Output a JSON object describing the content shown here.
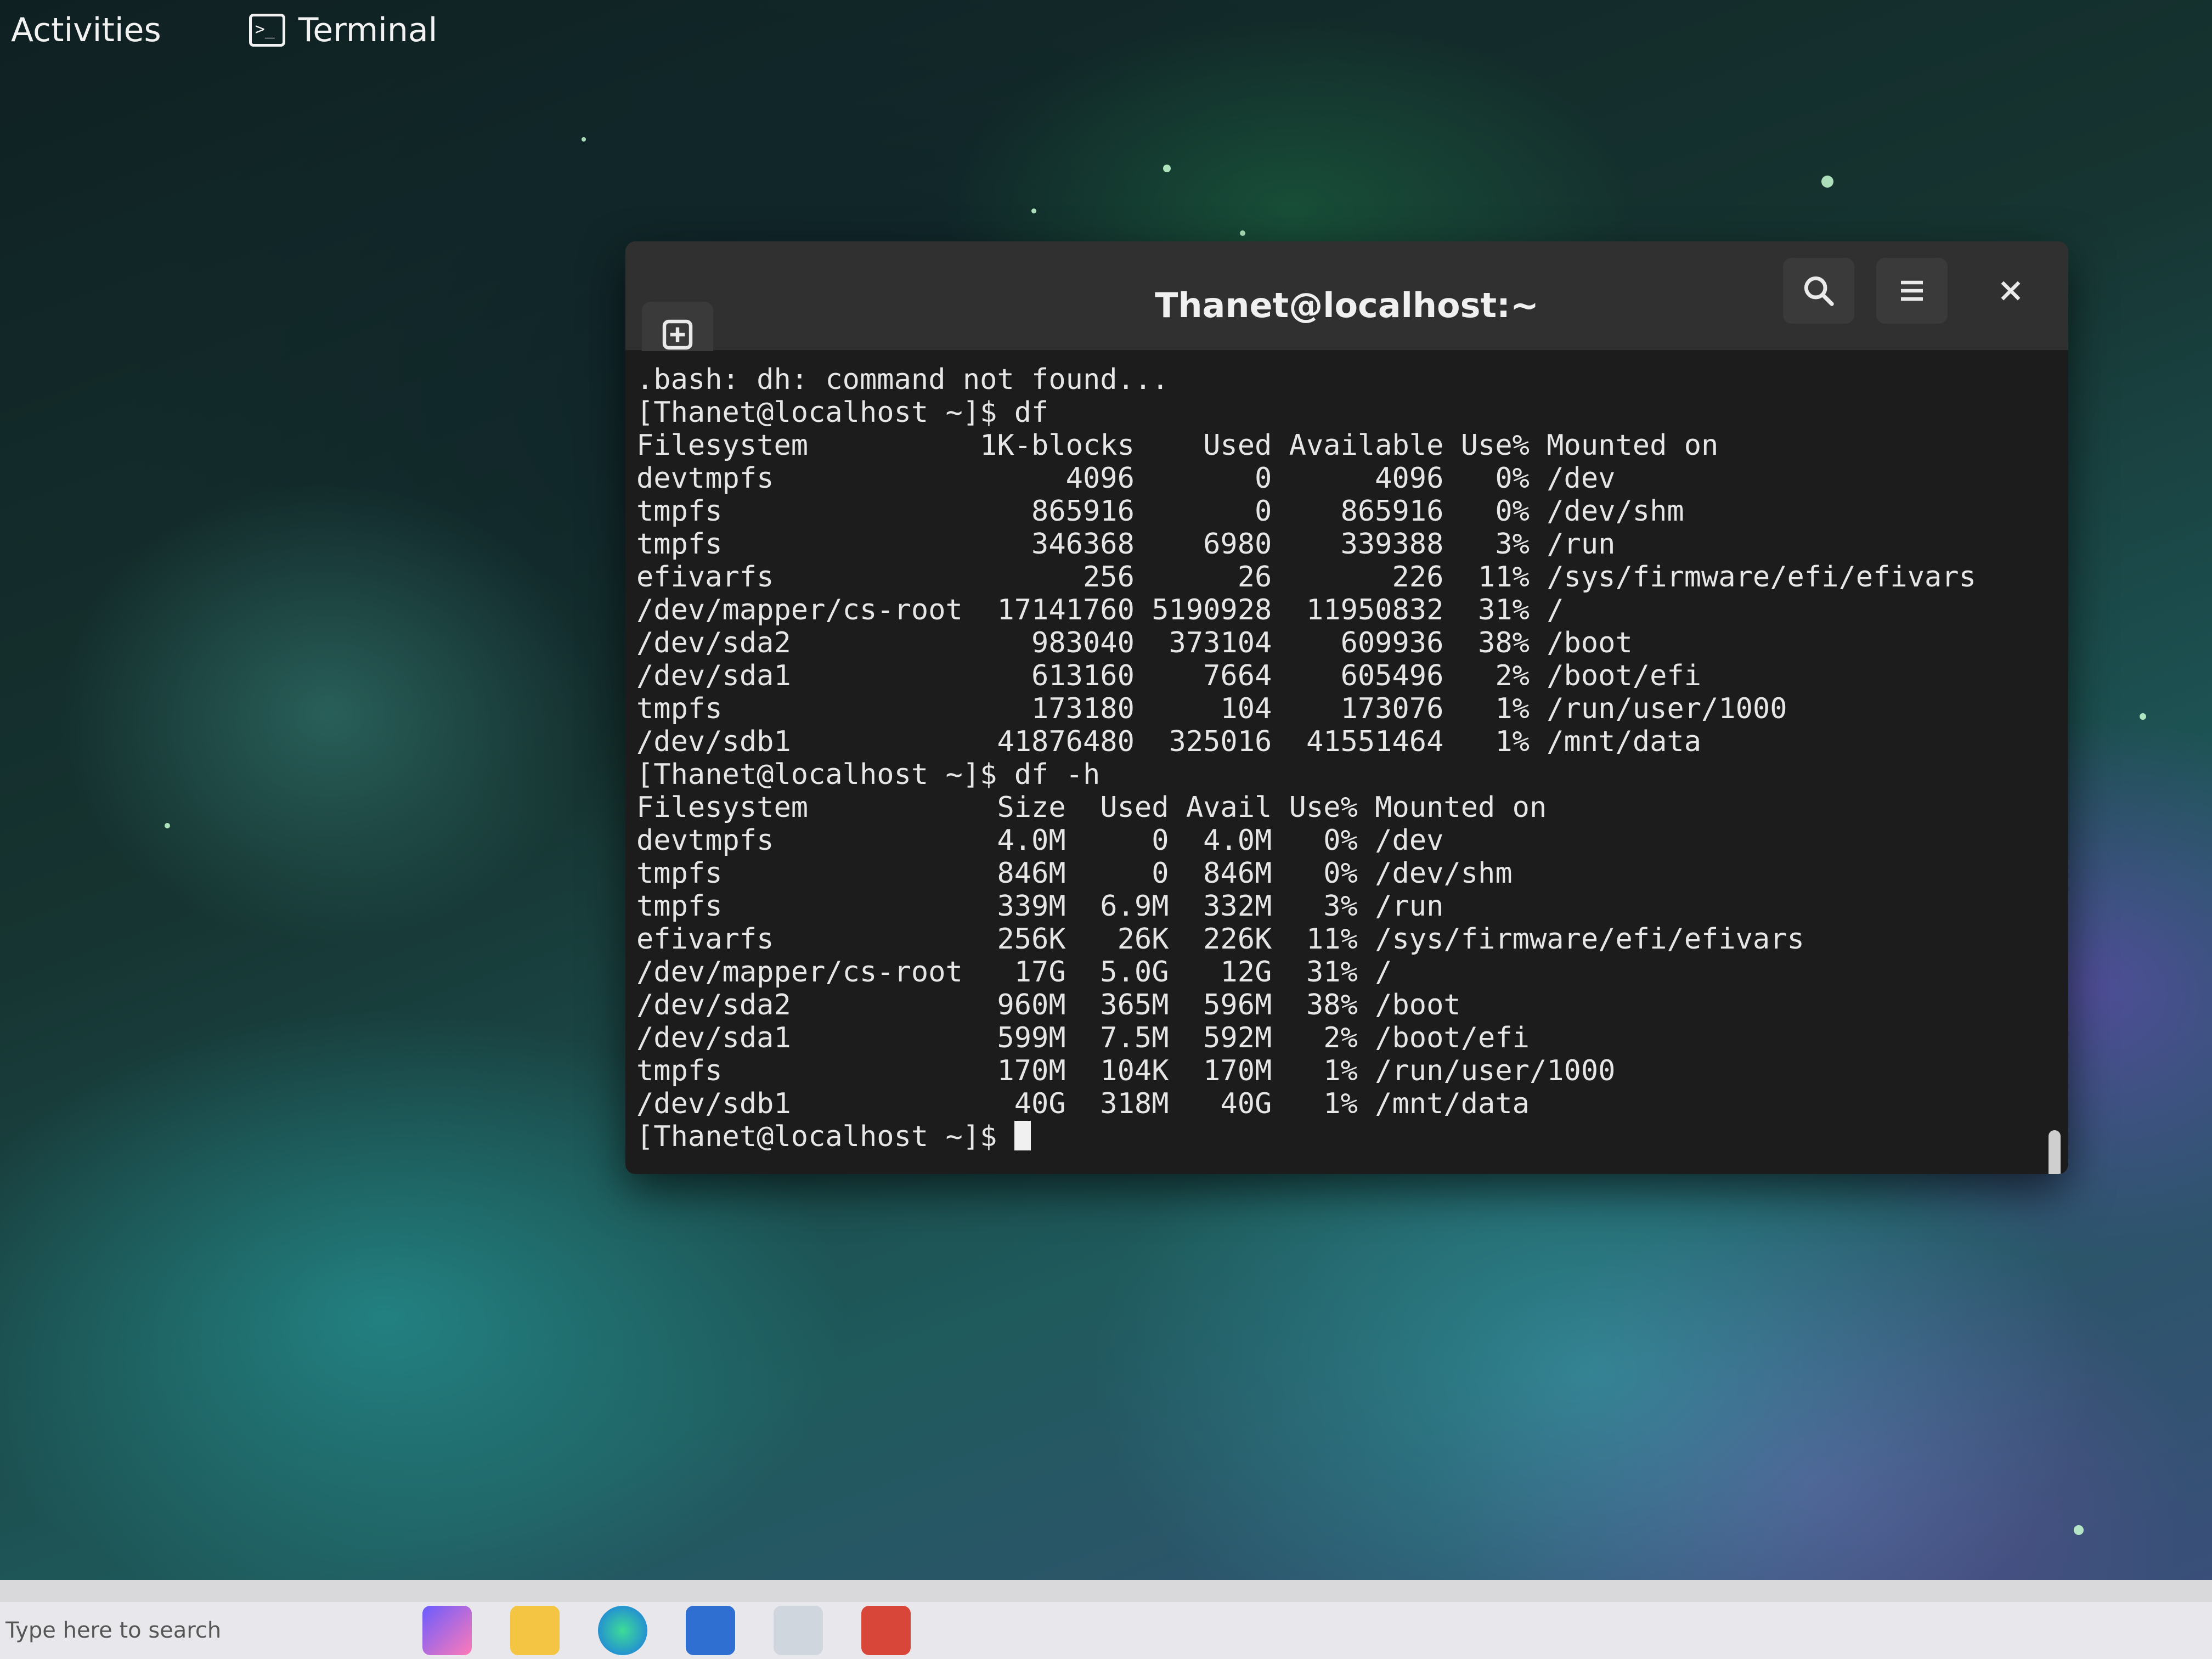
{
  "topbar": {
    "activities_label": "Activities",
    "app_name": "Terminal",
    "app_icon": "terminal-icon"
  },
  "window": {
    "title": "Thanet@localhost:~",
    "buttons": {
      "new_tab_icon": "new-tab-icon",
      "search_icon": "search-icon",
      "menu_icon": "hamburger-menu-icon",
      "close_icon": "close-icon"
    }
  },
  "terminal": {
    "lines": [
      ".bash: dh: command not found...",
      "[Thanet@localhost ~]$ df",
      "Filesystem          1K-blocks    Used Available Use% Mounted on",
      "devtmpfs                 4096       0      4096   0% /dev",
      "tmpfs                  865916       0    865916   0% /dev/shm",
      "tmpfs                  346368    6980    339388   3% /run",
      "efivarfs                  256      26       226  11% /sys/firmware/efi/efivars",
      "/dev/mapper/cs-root  17141760 5190928  11950832  31% /",
      "/dev/sda2              983040  373104    609936  38% /boot",
      "/dev/sda1              613160    7664    605496   2% /boot/efi",
      "tmpfs                  173180     104    173076   1% /run/user/1000",
      "/dev/sdb1            41876480  325016  41551464   1% /mnt/data",
      "[Thanet@localhost ~]$ df -h",
      "Filesystem           Size  Used Avail Use% Mounted on",
      "devtmpfs             4.0M     0  4.0M   0% /dev",
      "tmpfs                846M     0  846M   0% /dev/shm",
      "tmpfs                339M  6.9M  332M   3% /run",
      "efivarfs             256K   26K  226K  11% /sys/firmware/efi/efivars",
      "/dev/mapper/cs-root   17G  5.0G   12G  31% /",
      "/dev/sda2            960M  365M  596M  38% /boot",
      "/dev/sda1            599M  7.5M  592M   2% /boot/efi",
      "tmpfs                170M  104K  170M   1% /run/user/1000",
      "/dev/sdb1             40G  318M   40G   1% /mnt/data"
    ],
    "prompt": "[Thanet@localhost ~]$ "
  },
  "taskbar": {
    "search_hint": "Type here to search",
    "icons": [
      "copilot-icon",
      "file-explorer-icon",
      "edge-icon",
      "virtualbox-icon",
      "app-icon",
      "app-icon"
    ]
  }
}
